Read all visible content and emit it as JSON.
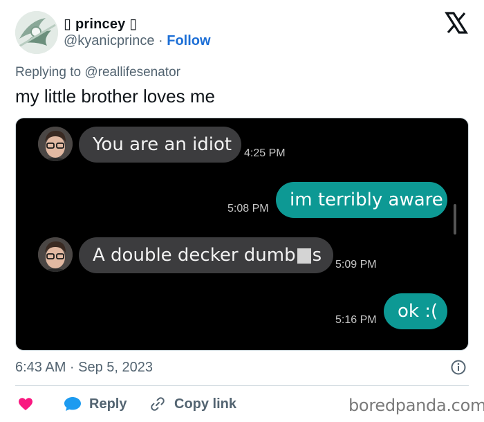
{
  "user": {
    "display_name": "▯ princey ▯",
    "handle": "@kyanicprince",
    "separator": " · ",
    "follow_label": "Follow"
  },
  "tweet": {
    "replying_prefix": "Replying to ",
    "replying_mention": "@reallifesenator",
    "text": "my little brother loves me",
    "timestamp": "6:43 AM · Sep 5, 2023"
  },
  "chat": {
    "messages": [
      {
        "side": "in",
        "text": "You are an idiot",
        "time": "4:25 PM"
      },
      {
        "side": "out",
        "text": "im terribly aware",
        "time": "5:08 PM"
      },
      {
        "side": "in",
        "text_before": "A double decker dumb",
        "text_after": "s",
        "time": "5:09 PM"
      },
      {
        "side": "out",
        "text": "ok :(",
        "time": "5:16 PM"
      }
    ]
  },
  "actions": {
    "reply_label": "Reply",
    "copy_link_label": "Copy link"
  },
  "watermark": "boredpanda.com",
  "colors": {
    "follow": "#1d6fd6",
    "outgoing_bubble": "#0d9994",
    "incoming_bubble": "#3c3c3e",
    "like_heart": "#f91880",
    "reply_bubble_icon": "#1d9bf0",
    "muted_text": "#536471"
  },
  "icons": [
    "x-logo-icon",
    "info-icon",
    "heart-icon",
    "reply-bubble-icon",
    "link-icon"
  ]
}
